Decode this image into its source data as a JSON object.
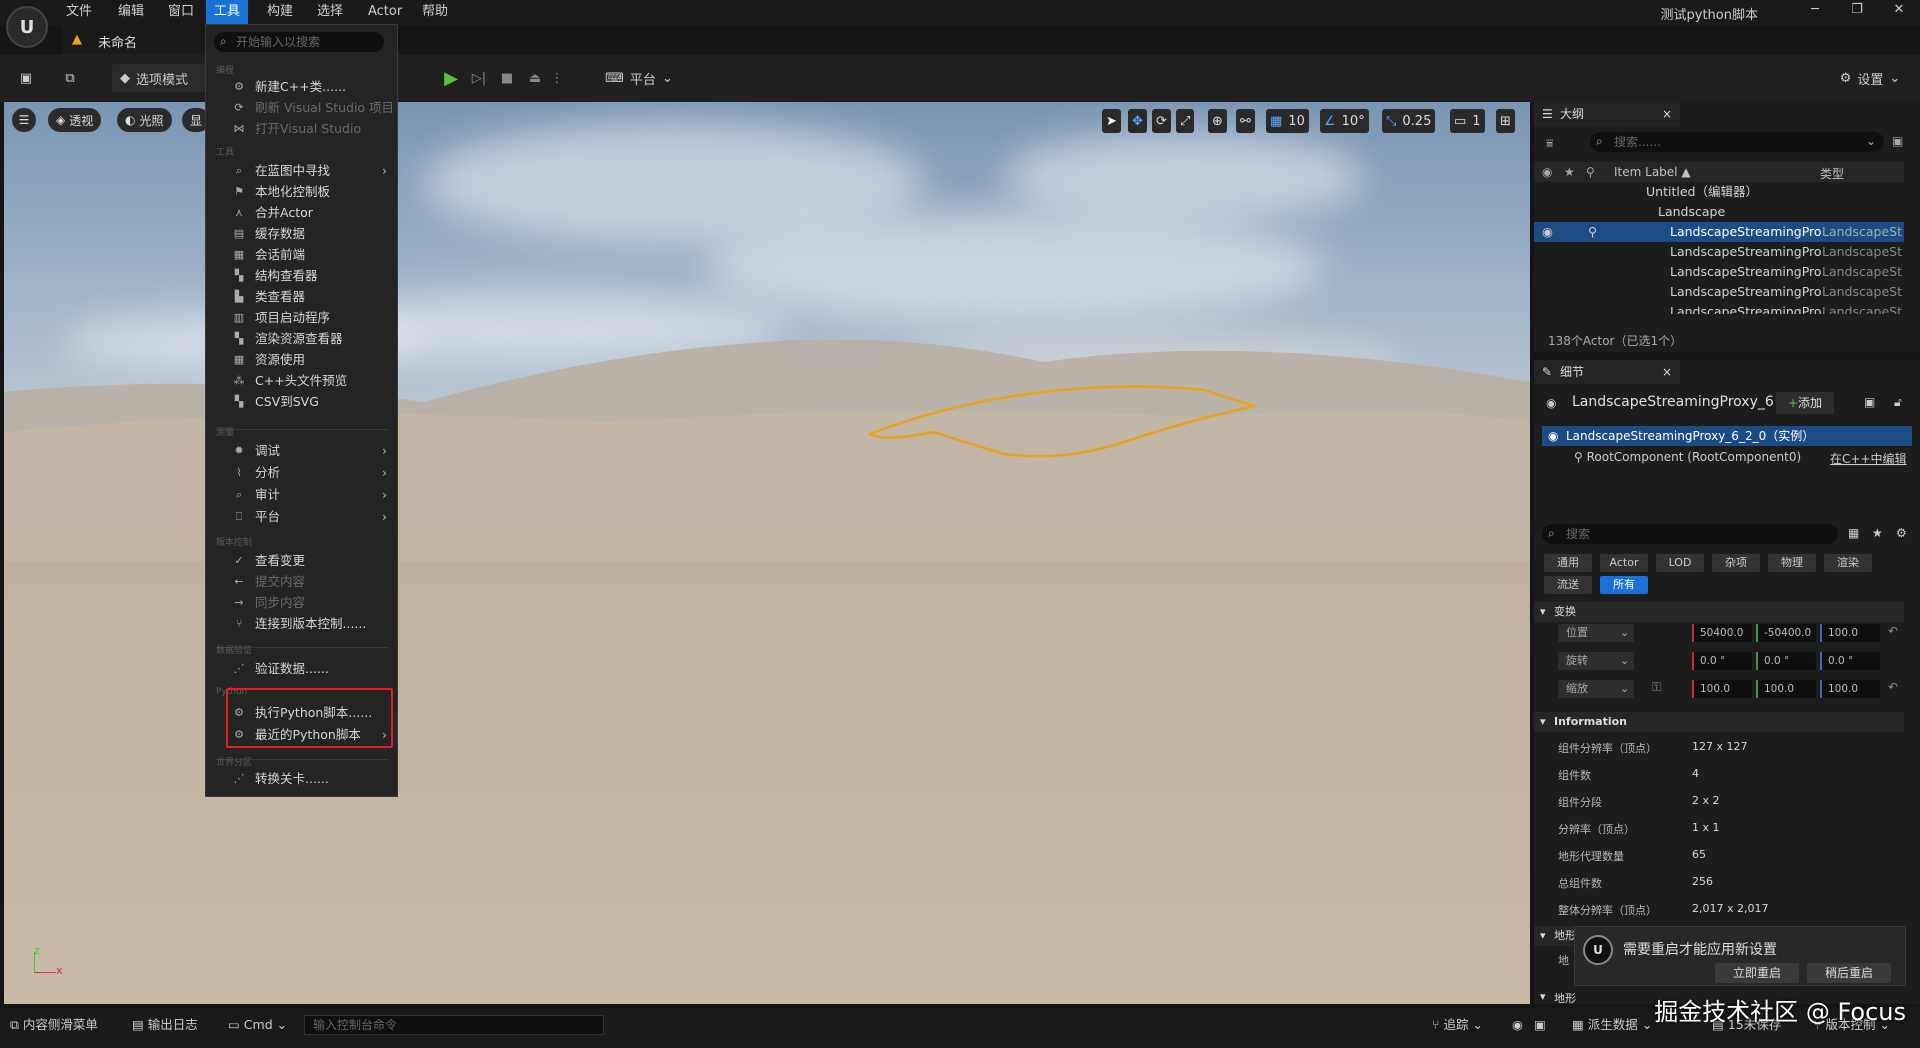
{
  "menubar": {
    "items": [
      "文件",
      "编辑",
      "窗口",
      "工具",
      "构建",
      "选择",
      "Actor",
      "帮助"
    ],
    "active": "工具"
  },
  "window": {
    "title": "测试python脚本"
  },
  "tab": {
    "label": "未命名"
  },
  "toolbar": {
    "mode": "选项模式",
    "platform": "平台",
    "settings": "设置"
  },
  "viewport": {
    "perspective": "透视",
    "lighting": "光照",
    "show": "显",
    "grid_snap": "10",
    "rot_snap": "10°",
    "scale_snap": "0.25",
    "camera_speed": "1",
    "outline_color": "#e8a21c"
  },
  "tools_menu": {
    "search_placeholder": "开始输入以搜索",
    "sec_programming": "编程",
    "new_cpp": "新建C++类......",
    "refresh_vs": "刷新 Visual Studio 项目",
    "open_vs": "打开Visual Studio",
    "sec_tools": "工具",
    "find_in_bp": "在蓝图中寻找",
    "localization": "本地化控制板",
    "merge_actor": "合并Actor",
    "cache_data": "缓存数据",
    "session_frontend": "会话前端",
    "struct_viewer": "结构查看器",
    "class_viewer": "类查看器",
    "project_launcher": "项目启动程序",
    "render_resource_viewer": "渲染资源查看器",
    "asset_usage": "资源使用",
    "cpp_header_preview": "C++头文件预览",
    "csv_to_svg": "CSV到SVG",
    "sec_instrument": "测量",
    "debug": "调试",
    "profile": "分析",
    "audit": "审计",
    "platform": "平台",
    "sec_source": "版本控制",
    "view_changes": "查看变更",
    "submit": "提交内容",
    "sync": "同步内容",
    "connect_source": "连接到版本控制......",
    "sec_data_validation": "数据验证",
    "validate_data": "验证数据......",
    "sec_python": "Python",
    "exec_python": "执行Python脚本......",
    "recent_python": "最近的Python脚本",
    "sec_world_partition": "世界分区",
    "convert_level": "转换关卡......"
  },
  "outliner": {
    "title": "大纲",
    "search_placeholder": "搜索......",
    "col_label": "Item Label ▲",
    "col_type": "类型",
    "root": "Untitled（编辑器）",
    "landscape": "Landscape",
    "rows": [
      {
        "label": "LandscapeStreamingPro",
        "type": "LandscapeSt"
      },
      {
        "label": "LandscapeStreamingPro",
        "type": "LandscapeSt"
      },
      {
        "label": "LandscapeStreamingPro",
        "type": "LandscapeSt"
      },
      {
        "label": "LandscapeStreamingPro",
        "type": "LandscapeSt"
      },
      {
        "label": "LandscapeStreamingPro",
        "type": "LandscapeSt"
      }
    ],
    "count": "138个Actor（已选1个）"
  },
  "details": {
    "title": "细节",
    "actor_name": "LandscapeStreamingProxy_6",
    "add": "添加",
    "instance": "LandscapeStreamingProxy_6_2_0（实例）",
    "root_component": "RootComponent (RootComponent0)",
    "edit_in_cpp": "在C++中编辑",
    "search_placeholder": "搜索",
    "filters": [
      "通用",
      "Actor",
      "LOD",
      "杂项",
      "物理",
      "渲染",
      "流送",
      "所有"
    ],
    "active_filter": "所有",
    "transform_title": "变换",
    "location": "位置",
    "rotation": "旋转",
    "scale": "缩放",
    "loc_values": [
      "50400.0",
      "-50400.0",
      "100.0"
    ],
    "rot_values": [
      "0.0 °",
      "0.0 °",
      "0.0 °"
    ],
    "scale_values": [
      "100.0",
      "100.0",
      "100.0"
    ],
    "info_title": "Information",
    "info": [
      {
        "label": "组件分辨率（顶点）",
        "value": "127 x 127"
      },
      {
        "label": "组件数",
        "value": "4"
      },
      {
        "label": "组件分段",
        "value": "2 x 2"
      },
      {
        "label": "分辨率（顶点）",
        "value": "1 x 1"
      },
      {
        "label": "地形代理数量",
        "value": "65"
      },
      {
        "label": "总组件数",
        "value": "256"
      },
      {
        "label": "整体分辨率（顶点）",
        "value": "2,017 x 2,017"
      }
    ],
    "section_landscape": "地形",
    "section_landscape2": "地形",
    "section_partial": "地"
  },
  "toast": {
    "message": "需要重启才能应用新设置",
    "restart_now": "立即重启",
    "restart_later": "稍后重启"
  },
  "statusbar": {
    "content_drawer": "内容侧滑菜单",
    "output_log": "输出日志",
    "cmd": "Cmd",
    "console_placeholder": "输入控制台命令",
    "trace": "追踪",
    "derived_data": "派生数据",
    "unsaved": "15未保存",
    "source_control": "版本控制"
  },
  "watermark": "掘金技术社区 @ Focus"
}
